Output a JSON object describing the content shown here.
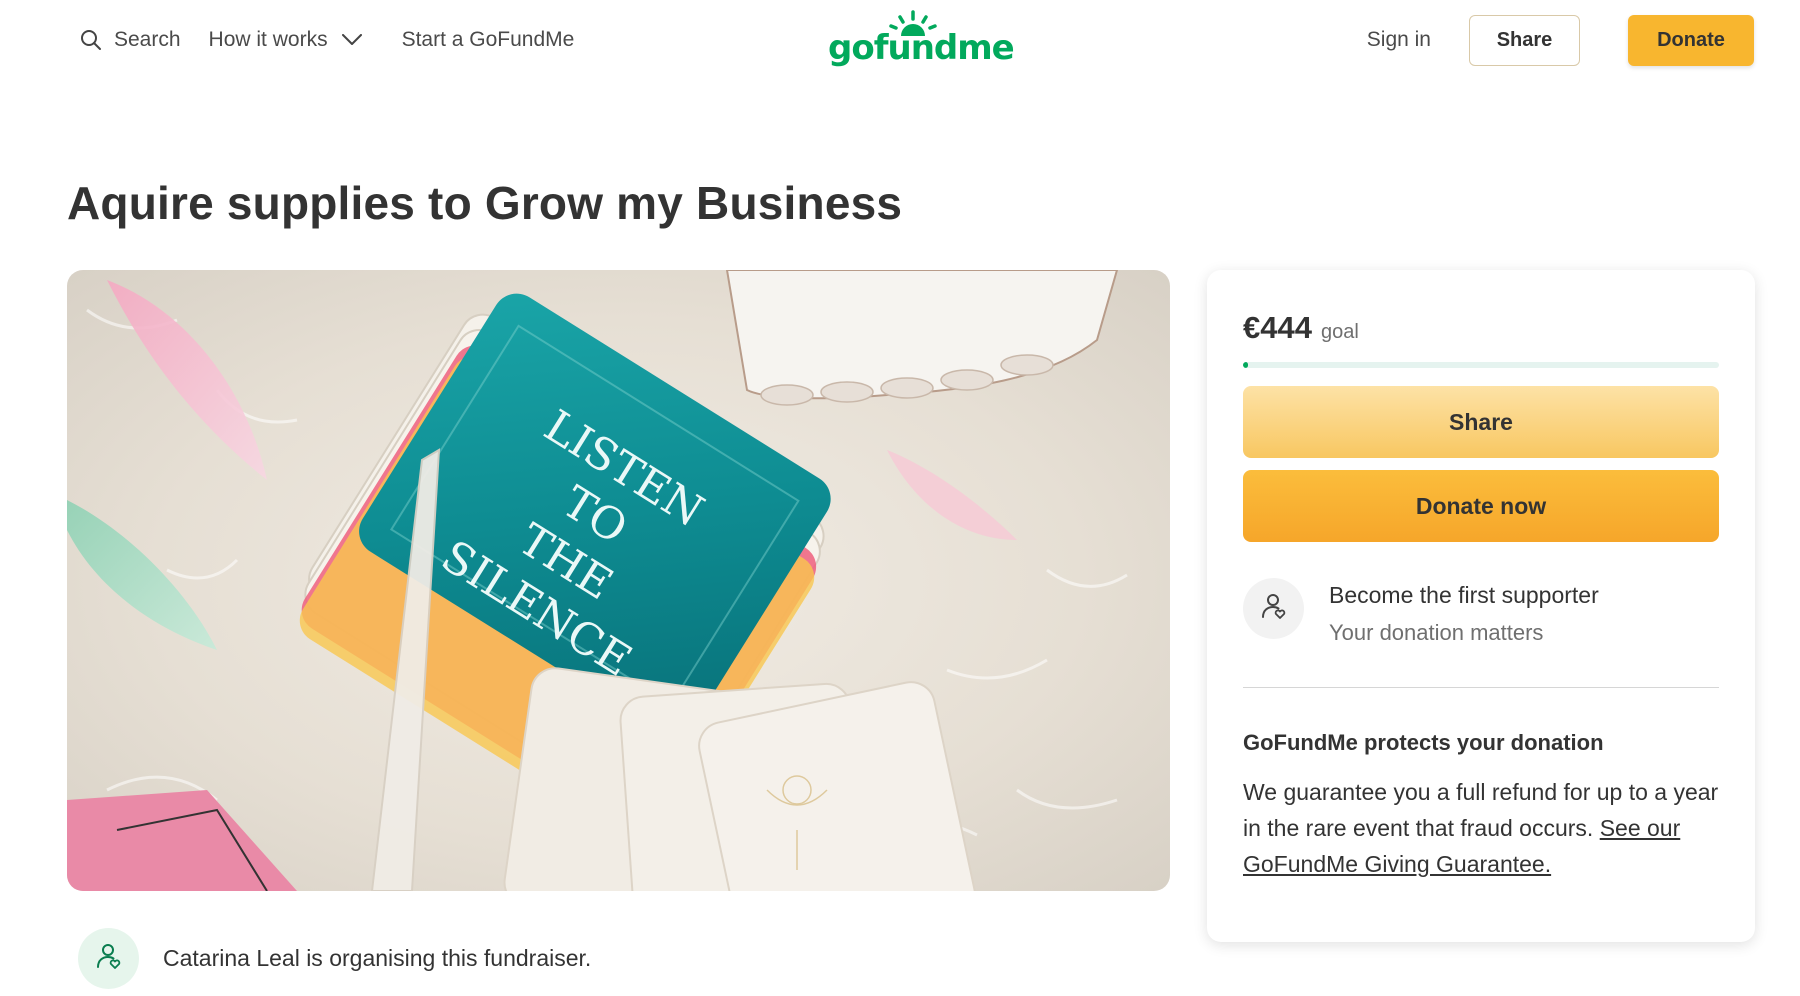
{
  "header": {
    "search_label": "Search",
    "how_it_works_label": "How it works",
    "start_label": "Start a GoFundMe",
    "logo_text": "gofundme",
    "signin_label": "Sign in",
    "share_label": "Share",
    "donate_label": "Donate",
    "icons": {
      "search": "search-icon",
      "chevron": "chevron-down-icon"
    }
  },
  "campaign": {
    "title": "Aquire supplies to Grow my Business",
    "hero_image": {
      "card_text": [
        "LISTEN",
        "TO",
        "THE",
        "SILENCE"
      ]
    },
    "organiser_text": "Catarina Leal is organising this fundraiser."
  },
  "donation_card": {
    "goal_amount": "€444",
    "goal_label": "goal",
    "progress_fraction": 0.01,
    "share_label": "Share",
    "donate_label": "Donate now",
    "supporter_title": "Become the first supporter",
    "supporter_subtitle": "Your donation matters",
    "protect_title": "GoFundMe protects your donation",
    "protect_body": "We guarantee you a full refund for up to a year in the rare event that fraud occurs.",
    "protect_link": "See our GoFundMe Giving Guarantee."
  },
  "colors": {
    "brand_green": "#02a95c",
    "donate_orange": "#f8b62f",
    "share_light": "#fde2a6"
  }
}
